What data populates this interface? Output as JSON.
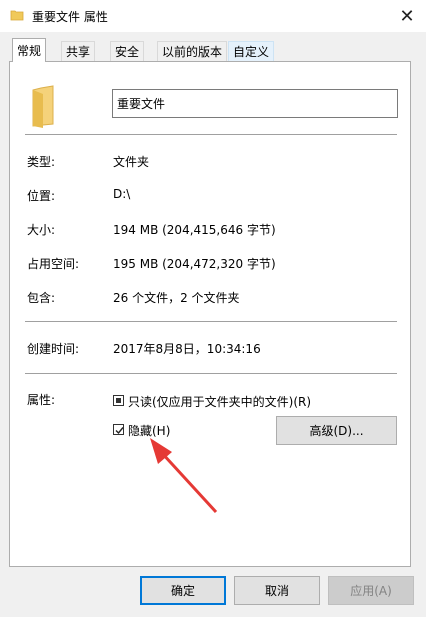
{
  "window": {
    "title": "重要文件 属性",
    "close_glyph": "✕"
  },
  "tabs": [
    {
      "label": "常规"
    },
    {
      "label": "共享"
    },
    {
      "label": "安全"
    },
    {
      "label": "以前的版本"
    },
    {
      "label": "自定义"
    }
  ],
  "general": {
    "name_value": "重要文件",
    "rows": [
      {
        "label": "类型:",
        "value": "文件夹"
      },
      {
        "label": "位置:",
        "value": "D:\\"
      },
      {
        "label": "大小:",
        "value": "194 MB (204,415,646 字节)"
      },
      {
        "label": "占用空间:",
        "value": "195 MB (204,472,320 字节)"
      },
      {
        "label": "包含:",
        "value": "26 个文件，2 个文件夹"
      }
    ],
    "created": {
      "label": "创建时间:",
      "value": "2017年8月8日，10:34:16"
    },
    "attributes": {
      "label": "属性:",
      "readonly_label": "只读(仅应用于文件夹中的文件)(R)",
      "readonly_state": "indeterminate",
      "hidden_label": "隐藏(H)",
      "hidden_checked": true,
      "advanced_label": "高级(D)..."
    }
  },
  "footer": {
    "ok_label": "确定",
    "cancel_label": "取消",
    "apply_label": "应用(A)"
  },
  "colors": {
    "folder": "#f0c95a",
    "accent": "#0078d7",
    "arrow": "#e53935"
  },
  "icons": {
    "title_folder": "folder-icon",
    "big_folder": "folder-icon",
    "close": "close-icon",
    "annotation": "arrow-annotation"
  }
}
